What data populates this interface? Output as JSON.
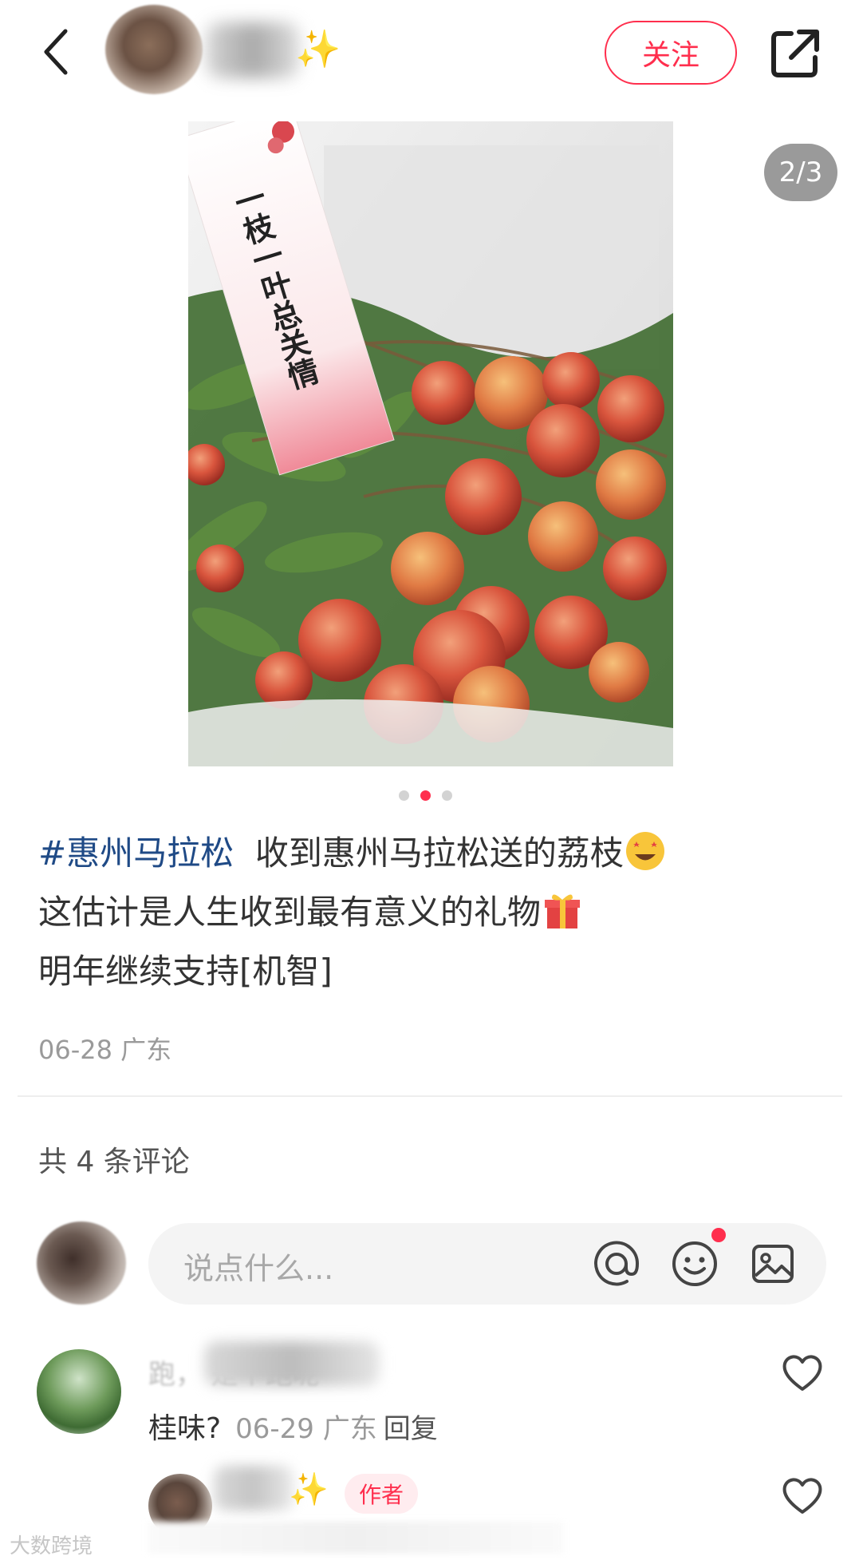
{
  "header": {
    "follow_label": "关注",
    "name_sparkle": "✨"
  },
  "gallery": {
    "counter": "2/3",
    "current_index": 2,
    "total": 3,
    "tag_text": "一枝一叶总关情"
  },
  "post": {
    "hashtag": "#惠州马拉松",
    "line1": "收到惠州马拉松送的荔枝",
    "line2": "这估计是人生收到最有意义的礼物",
    "line3": "明年继续支持[机智]",
    "meta": "06-28 广东"
  },
  "comments_section": {
    "count_label": "共 4 条评论",
    "input_placeholder": "说点什么..."
  },
  "comments": [
    {
      "name_visible": "跑，      是个跑呢",
      "text": "桂味?",
      "meta": "06-29 广东",
      "reply_label": "回复"
    },
    {
      "name_sparkle": "✨",
      "badge": "作者"
    }
  ],
  "watermark": "大数跨境",
  "colors": {
    "accent": "#ff2e4d",
    "hashtag": "#1f4a86",
    "meta_gray": "#9a9a9a"
  }
}
